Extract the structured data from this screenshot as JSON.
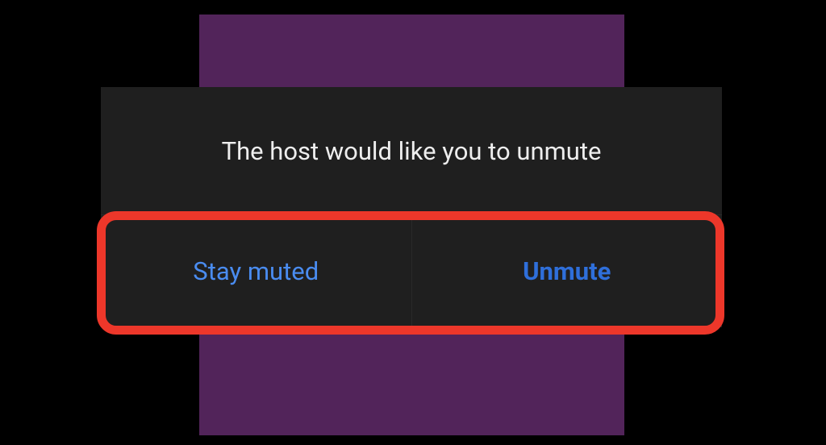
{
  "dialog": {
    "message": "The host would like you to unmute",
    "buttons": {
      "stay_muted_label": "Stay muted",
      "unmute_label": "Unmute"
    }
  },
  "colors": {
    "background": "#000000",
    "purple_panel": "#52245a",
    "dialog_bg": "#1f1f1f",
    "message_text": "#eeeeee",
    "stay_muted_text": "#4a8cf0",
    "unmute_text": "#2f6fda",
    "highlight_border": "#ed372a"
  }
}
